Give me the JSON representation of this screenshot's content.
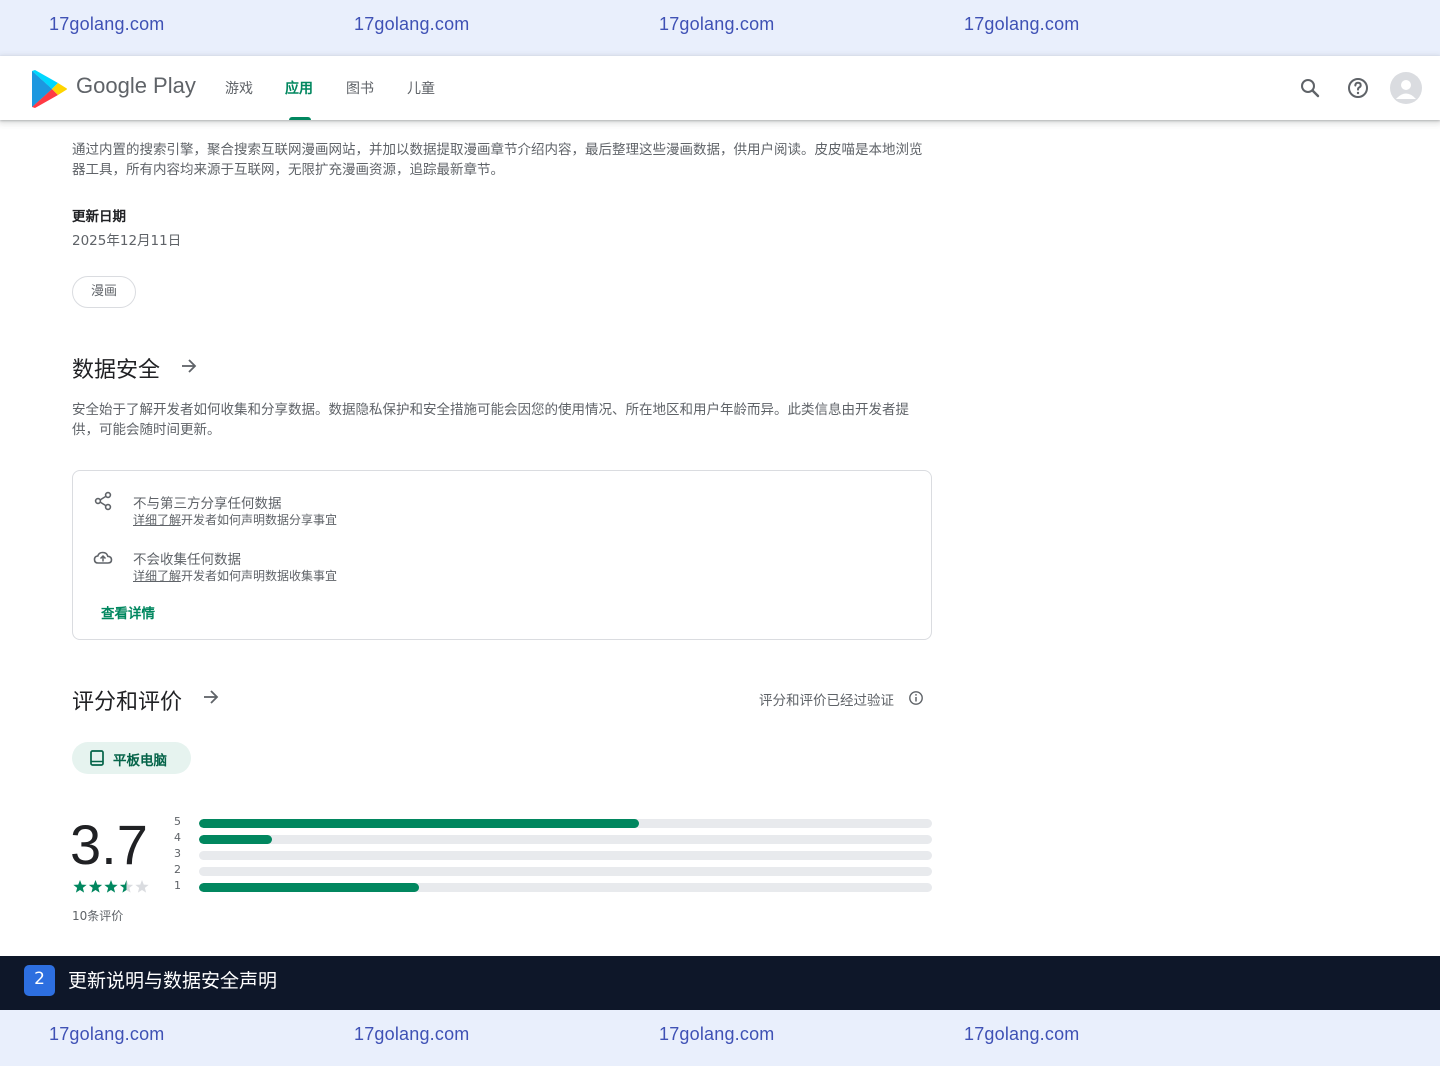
{
  "watermark": {
    "top": [
      "17golang.com",
      "17golang.com",
      "17golang.com",
      "17golang.com"
    ],
    "bottom": [
      "17golang.com",
      "17golang.com",
      "17golang.com",
      "17golang.com"
    ]
  },
  "header": {
    "brand": "Google Play",
    "nav": [
      "游戏",
      "应用",
      "图书",
      "儿童"
    ],
    "active_nav": "应用"
  },
  "about": {
    "description": "通过内置的搜索引擎，聚合搜索互联网漫画网站，并加以数据提取漫画章节介绍内容，最后整理这些漫画数据，供用户阅读。皮皮喵是本地浏览器工具，所有内容均来源于互联网，无限扩充漫画资源，追踪最新章节。",
    "updated_label": "更新日期",
    "updated_value": "2025年12月11日",
    "tag": "漫画"
  },
  "data_safety": {
    "title": "数据安全",
    "description": "安全始于了解开发者如何收集和分享数据。数据隐私保护和安全措施可能会因您的使用情况、所在地区和用户年龄而异。此类信息由开发者提供，可能会随时间更新。",
    "items": [
      {
        "title": "不与第三方分享任何数据",
        "link": "详细了解",
        "rest": "开发者如何声明数据分享事宜",
        "icon": "share-icon"
      },
      {
        "title": "不会收集任何数据",
        "link": "详细了解",
        "rest": "开发者如何声明数据收集事宜",
        "icon": "cloud-upload-icon"
      }
    ],
    "details_label": "查看详情"
  },
  "ratings": {
    "title": "评分和评价",
    "verified": "评分和评价已经过验证",
    "device_chip": "平板电脑",
    "score": "3.7",
    "stars": 3.5,
    "review_count": "10条评价",
    "distribution": [
      {
        "star": "5",
        "fraction": 0.6
      },
      {
        "star": "4",
        "fraction": 0.1
      },
      {
        "star": "3",
        "fraction": 0.0
      },
      {
        "star": "2",
        "fraction": 0.0
      },
      {
        "star": "1",
        "fraction": 0.3
      }
    ]
  },
  "caption": {
    "number": "2",
    "text": "更新说明与数据安全声明"
  },
  "colors": {
    "accent": "#01875f",
    "caption_bg": "#0e1729",
    "watermark_bg": "#e9effc"
  }
}
